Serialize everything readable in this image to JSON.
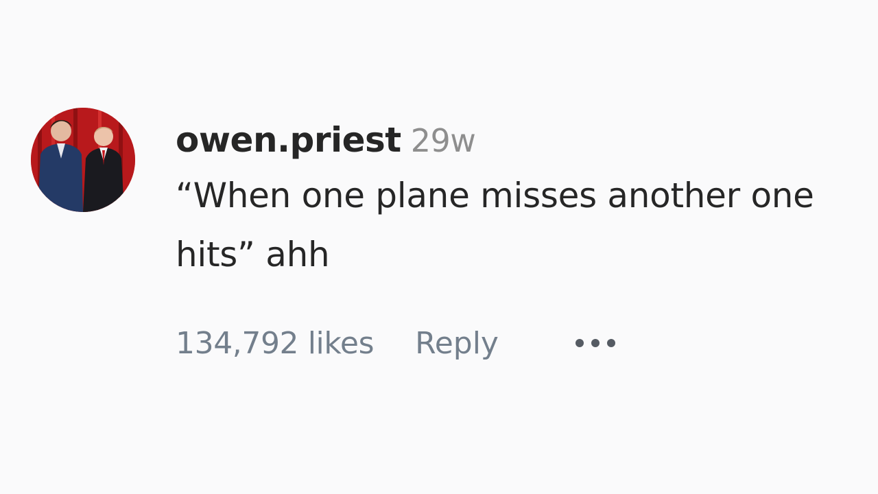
{
  "comment": {
    "username": "owen.priest",
    "timestamp": "29w",
    "text": "“When one plane misses another one hits” ahh",
    "likes_label": "134,792 likes",
    "reply_label": "Reply",
    "more_icon": "more-horizontal-icon"
  },
  "colors": {
    "background": "#fafafb",
    "text_primary": "#262626",
    "text_secondary": "#737f8c"
  }
}
